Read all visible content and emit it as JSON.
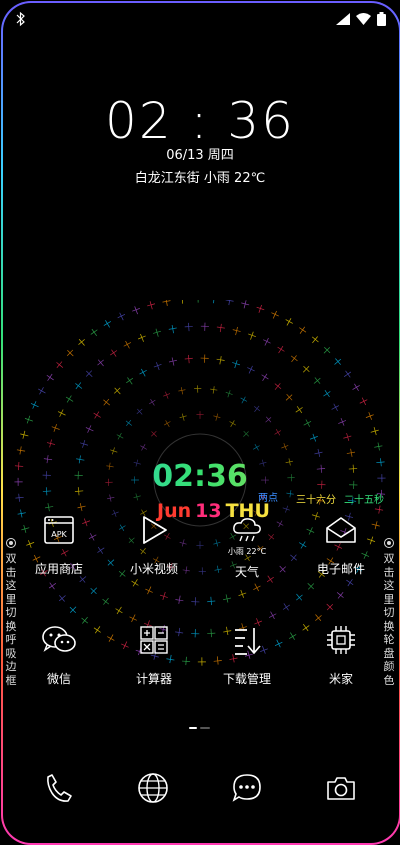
{
  "lockscreen": {
    "time": "02 : 36",
    "date": "06/13 周四",
    "location_weather": "白龙江东街 小雨 22℃"
  },
  "dial": {
    "digital_time": "02:36",
    "month": "Jun",
    "day": "13",
    "weekday": "THU",
    "hour_label": "两点",
    "minute_label": "三十六分",
    "second_label": "二十五秒",
    "weather_small": "小雨 22°C",
    "ring_colors": [
      "#ff2d55",
      "#ff9500",
      "#ffe000",
      "#34c759",
      "#00c7ff",
      "#5856d6",
      "#af52de"
    ]
  },
  "apps_row1": [
    {
      "name": "应用商店",
      "icon": "apk-store-icon"
    },
    {
      "name": "小米视频",
      "icon": "play-icon"
    },
    {
      "name": "天气",
      "icon": "weather-cloud-rain-icon"
    },
    {
      "name": "电子邮件",
      "icon": "mail-icon"
    }
  ],
  "apps_row2": [
    {
      "name": "微信",
      "icon": "wechat-icon"
    },
    {
      "name": "计算器",
      "icon": "calculator-icon"
    },
    {
      "name": "下载管理",
      "icon": "download-icon"
    },
    {
      "name": "米家",
      "icon": "chip-icon"
    }
  ],
  "apk_label": "APK",
  "side_left": "双击这里切换呼吸边框",
  "side_right": "双击这里切换轮盘颜色",
  "dock": [
    "phone-icon",
    "browser-globe-icon",
    "message-bubble-icon",
    "camera-icon"
  ]
}
